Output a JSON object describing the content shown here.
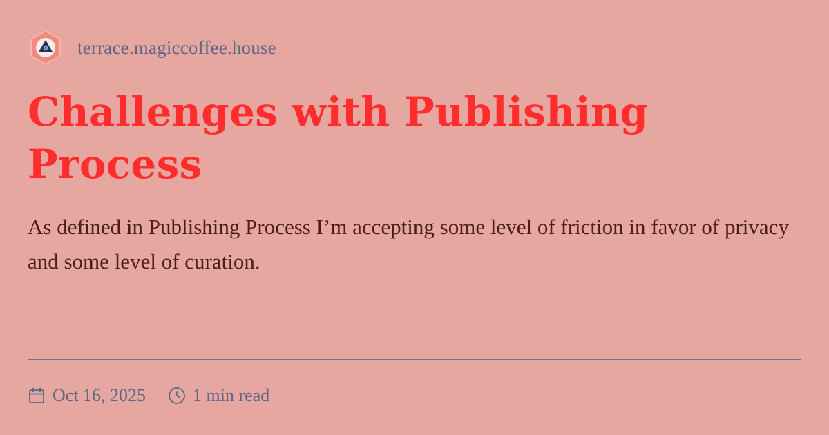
{
  "site": {
    "name": "terrace.magiccoffee.house",
    "logo_icon": "hexagon-eye-icon"
  },
  "post": {
    "title": "Challenges with Publishing Process",
    "summary": "As defined in Publishing Process I’m accepting some level of friction in favor of privacy and some level of curation.",
    "date": "Oct 16, 2025",
    "read_time": "1 min read"
  },
  "icons": {
    "date": "calendar-icon",
    "read_time": "clock-icon"
  },
  "colors": {
    "background": "#e6a7a0",
    "title": "#ff2d2d",
    "summary": "#4b1c1c",
    "muted": "#5d6687"
  }
}
